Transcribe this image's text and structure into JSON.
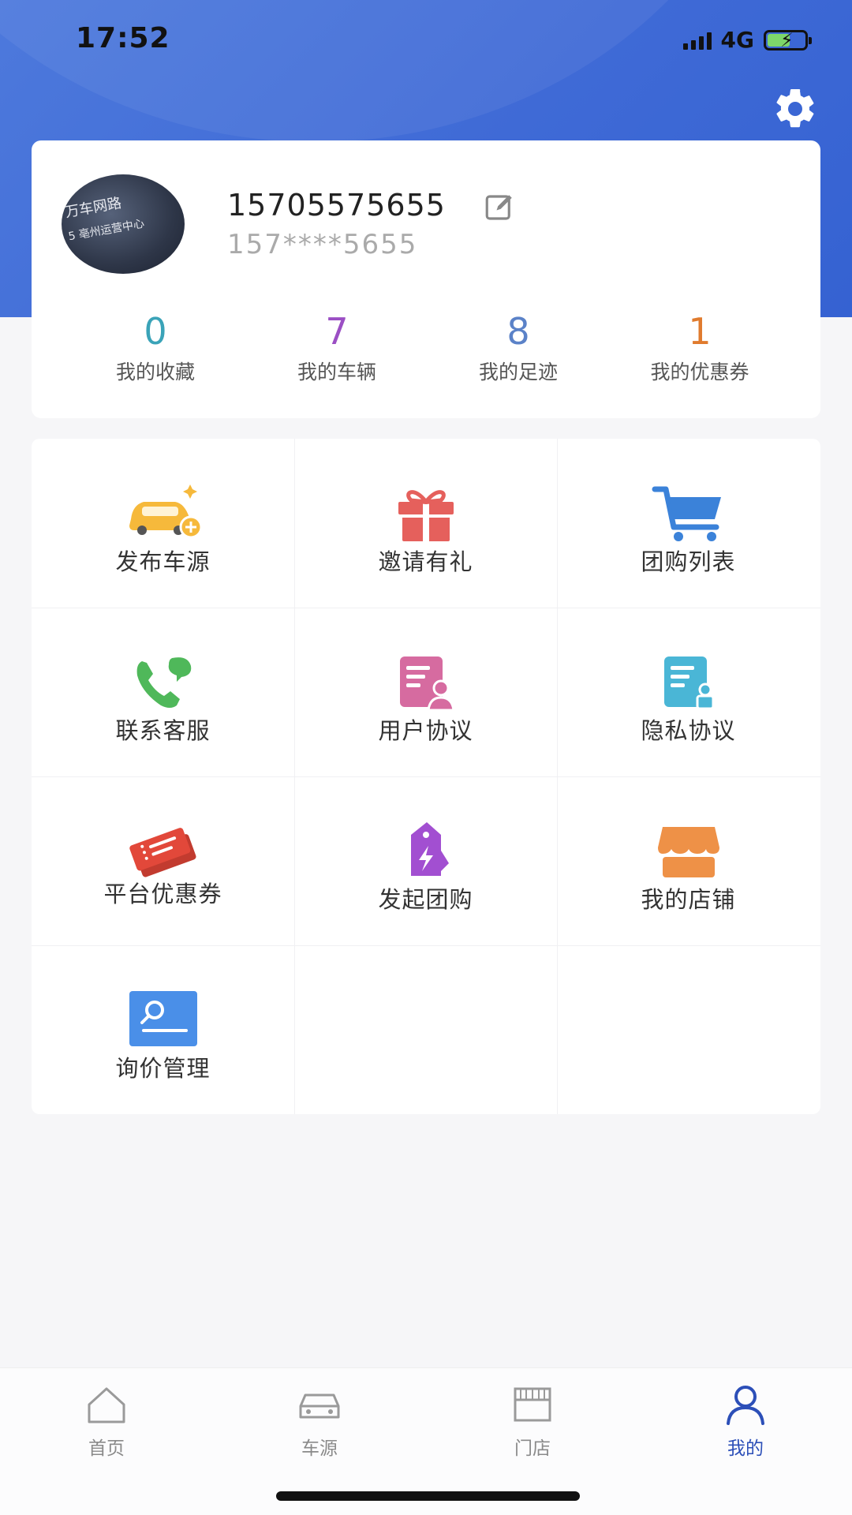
{
  "status_bar": {
    "time": "17:52",
    "network": "4G"
  },
  "profile": {
    "phone": "15705575655",
    "phone_masked": "157****5655",
    "avatar_text_line1": "万车网路",
    "avatar_text_line2": "5 亳州运营中心"
  },
  "stats": [
    {
      "value": "0",
      "label": "我的收藏",
      "color": "#3aa3b8"
    },
    {
      "value": "7",
      "label": "我的车辆",
      "color": "#9b4fc4"
    },
    {
      "value": "8",
      "label": "我的足迹",
      "color": "#5b82c8"
    },
    {
      "value": "1",
      "label": "我的优惠券",
      "color": "#e07b2e"
    }
  ],
  "menu": [
    {
      "label": "发布车源",
      "icon": "car-add-icon"
    },
    {
      "label": "邀请有礼",
      "icon": "gift-icon"
    },
    {
      "label": "团购列表",
      "icon": "cart-icon"
    },
    {
      "label": "联系客服",
      "icon": "phone-chat-icon"
    },
    {
      "label": "用户协议",
      "icon": "user-doc-icon"
    },
    {
      "label": "隐私协议",
      "icon": "privacy-doc-icon"
    },
    {
      "label": "平台优惠券",
      "icon": "coupon-icon"
    },
    {
      "label": "发起团购",
      "icon": "tag-lightning-icon"
    },
    {
      "label": "我的店铺",
      "icon": "store-icon"
    },
    {
      "label": "询价管理",
      "icon": "search-card-icon"
    }
  ],
  "tabs": [
    {
      "label": "首页",
      "icon": "home-icon"
    },
    {
      "label": "车源",
      "icon": "car-icon"
    },
    {
      "label": "门店",
      "icon": "shop-icon"
    },
    {
      "label": "我的",
      "icon": "user-icon",
      "active": true
    }
  ],
  "colors": {
    "header": "#3f6ad6",
    "accent": "#2c4fb8"
  }
}
